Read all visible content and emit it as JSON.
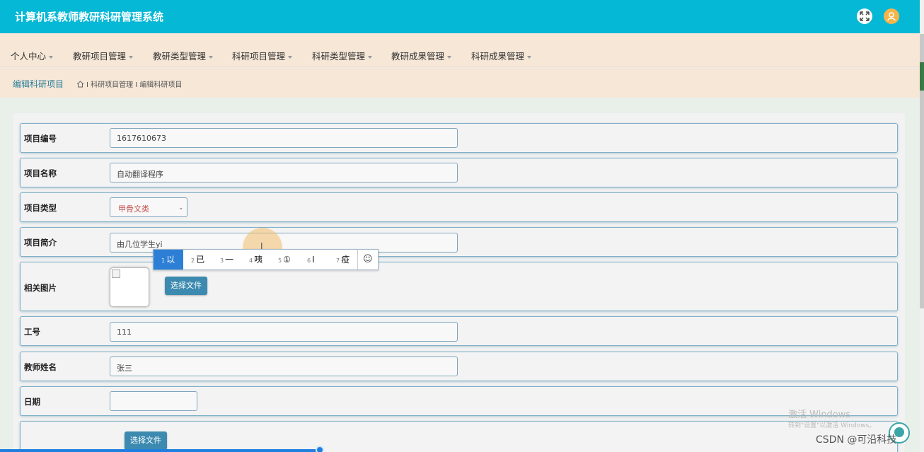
{
  "app": {
    "title": "计算机系教师教研科研管理系统"
  },
  "nav": {
    "items": [
      {
        "label": "个人中心"
      },
      {
        "label": "教研项目管理"
      },
      {
        "label": "教研类型管理"
      },
      {
        "label": "科研项目管理"
      },
      {
        "label": "科研类型管理"
      },
      {
        "label": "教研成果管理"
      },
      {
        "label": "科研成果管理"
      }
    ]
  },
  "breadcrumb": {
    "title": "编辑科研项目",
    "path": "I 科研项目管理 I 编辑科研项目"
  },
  "form": {
    "project_no": {
      "label": "项目编号",
      "value": "1617610673"
    },
    "project_name": {
      "label": "项目名称",
      "value": "自动翻译程序"
    },
    "project_type": {
      "label": "项目类型",
      "value": "甲骨文类"
    },
    "project_intro": {
      "label": "项目简介",
      "value": "由几位学生yi"
    },
    "image": {
      "label": "相关图片",
      "button": "选择文件"
    },
    "job_no": {
      "label": "工号",
      "value": "111"
    },
    "teacher_name": {
      "label": "教师姓名",
      "value": "张三"
    },
    "date": {
      "label": "日期",
      "value": ""
    },
    "file": {
      "button": "选择文件"
    }
  },
  "ime": {
    "candidates": [
      {
        "num": "1",
        "text": "以"
      },
      {
        "num": "2",
        "text": "已"
      },
      {
        "num": "3",
        "text": "一"
      },
      {
        "num": "4",
        "text": "咦"
      },
      {
        "num": "5",
        "text": "①"
      },
      {
        "num": "6",
        "text": "Ⅰ"
      },
      {
        "num": "7",
        "text": "疫"
      }
    ],
    "emoji": "☺"
  },
  "overlay": {
    "watermark_line1": "激活 Windows",
    "watermark_line2": "转到\"设置\"以激活 Windows。",
    "csdn": "CSDN @可沿科技"
  },
  "colors": {
    "header": "#05b8d6",
    "nav_bg": "#f6e7d7",
    "accent": "#3c8ab0",
    "ime_selected": "#2d7fd6"
  }
}
